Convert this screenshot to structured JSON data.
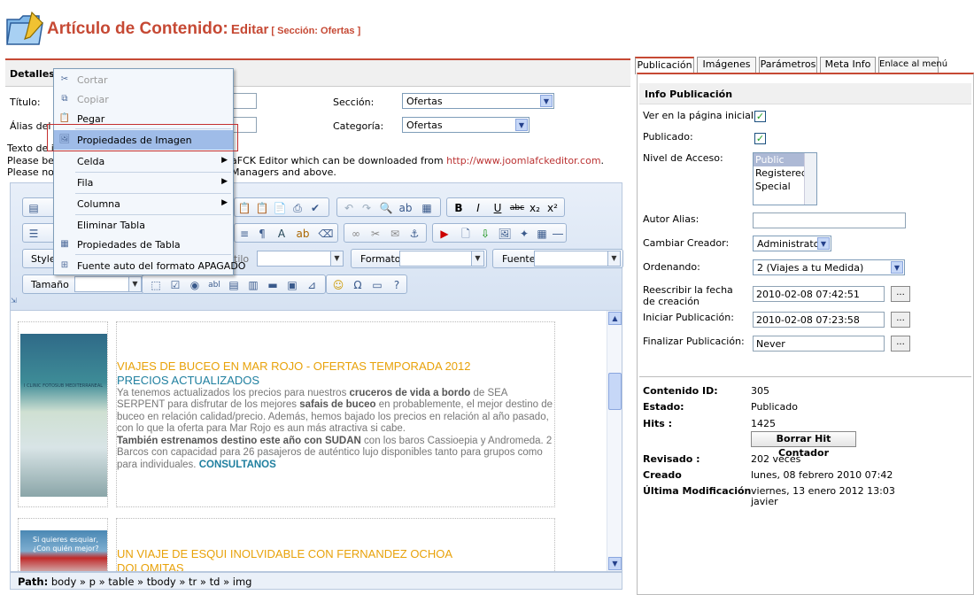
{
  "header": {
    "title_main": "Artículo de Contenido:",
    "title_mode": "Editar",
    "title_section": "[ Sección: Ofertas ]"
  },
  "details": {
    "header": "Detalles",
    "title_label": "Título:",
    "alias_label": "Álias del tí",
    "section_label": "Sección:",
    "section_value": "Ofertas",
    "category_label": "Categoría:",
    "category_value": "Ofertas",
    "intro_label": "Texto de in",
    "note_line1_a": "Please be a",
    "note_line1_b": "aFCK Editor which can be downloaded from ",
    "note_link": "http://www.joomlafckeditor.com",
    "note_line1_c": ".",
    "note_line2_a": "Please note",
    "note_line2_b": "Managers and above."
  },
  "toolbar": {
    "style_label": "Style",
    "style_partial": "tilo",
    "format_label": "Formato",
    "font_label": "Fuente",
    "size_label": "Tamaño"
  },
  "context_menu": {
    "items": [
      {
        "label": "Cortar",
        "icon": "scissors-icon"
      },
      {
        "label": "Copiar",
        "icon": "copy-icon"
      },
      {
        "label": "Pegar",
        "icon": "paste-icon"
      },
      {
        "label": "Propiedades de Imagen",
        "icon": "image-icon"
      },
      {
        "label": "Celda"
      },
      {
        "label": "Fila"
      },
      {
        "label": "Columna"
      },
      {
        "label": "Eliminar Tabla"
      },
      {
        "label": "Propiedades de Tabla",
        "icon": "table-icon"
      },
      {
        "label": "Fuente auto del formato APAGADO",
        "icon": "format-source-icon"
      }
    ],
    "highlight_color": "#9fbce8"
  },
  "content": {
    "article1": {
      "title": "VIAJES DE BUCEO EN MAR ROJO - OFERTAS TEMPORADA 2012",
      "subtitle": "PRECIOS ACTUALIZADOS",
      "p1_a": "Ya tenemos actualizados los precios para nuestros ",
      "p1_b": "cruceros de vida a bordo",
      "p1_c": " de SEA SERPENT para disfrutar de los mejores ",
      "p1_d": "safais de buceo",
      "p1_e": " en probablemente, el mejor destino de buceo en relación calidad/precio. Además, hemos bajado los precios en relación al año pasado, con lo que la oferta para Mar Rojo es aun más atractiva si cabe.",
      "p2_a": "También estrenamos destino este año con SUDAN",
      "p2_b": " con los baros Cassioepia y Andromeda. 2 Barcos con capacidad para 26 pasajeros de auténtico lujo disponibles tanto para grupos como para individuales. ",
      "p2_link": "CONSULTANOS"
    },
    "article2": {
      "title_line1": "UN VIAJE DE ESQUI INOLVIDABLE CON FERNANDEZ OCHOA",
      "title_line2": "DOLOMITAS"
    },
    "thumb1_caption": "I CLINIC FOTOSUB MEDITERRANEAL",
    "thumb2_caption_a": "Si quieres esquiar,",
    "thumb2_caption_b": "¿Con quién mejor?"
  },
  "path": {
    "label": "Path:",
    "value": "body » p » table » tbody » tr » td » img"
  },
  "tabs": [
    "Publicación",
    "Imágenes",
    "Parámetros",
    "Meta Info",
    "Enlace al menú"
  ],
  "publication": {
    "header": "Info Publicación",
    "frontpage_label": "Ver en la página inicial:",
    "published_label": "Publicado:",
    "access_label": "Nivel de Acceso:",
    "access_options": [
      "Public",
      "Registered",
      "Special"
    ],
    "author_alias_label": "Autor Alias:",
    "change_creator_label": "Cambiar Creador:",
    "creator_value": "Administrator",
    "ordering_label": "Ordenando:",
    "ordering_value": "2 (Viajes a tu Medida)",
    "override_date_label": "Reescribir la fecha de creación",
    "override_date_value": "2010-02-08 07:42:51",
    "start_label": "Iniciar Publicación:",
    "start_value": "2010-02-08 07:23:58",
    "finish_label": "Finalizar Publicación:",
    "finish_value": "Never",
    "dots": "..."
  },
  "info": {
    "id_label": "Contenido ID:",
    "id_value": "305",
    "state_label": "Estado:",
    "state_value": "Publicado",
    "hits_label": "Hits :",
    "hits_value": "1425",
    "reset_hits": "Borrar Hit Contador",
    "revised_label": "Revisado :",
    "revised_value": "202 veces",
    "created_label": "Creado",
    "created_value": "lunes, 08 febrero 2010 07:42",
    "modified_label": "Última Modificación",
    "modified_value": "viernes, 13 enero 2012 13:03",
    "modified_by": "javier"
  },
  "colors": {
    "accent": "#c64934",
    "link": "#1f7f9f",
    "heading_orange": "#e8a20a"
  }
}
